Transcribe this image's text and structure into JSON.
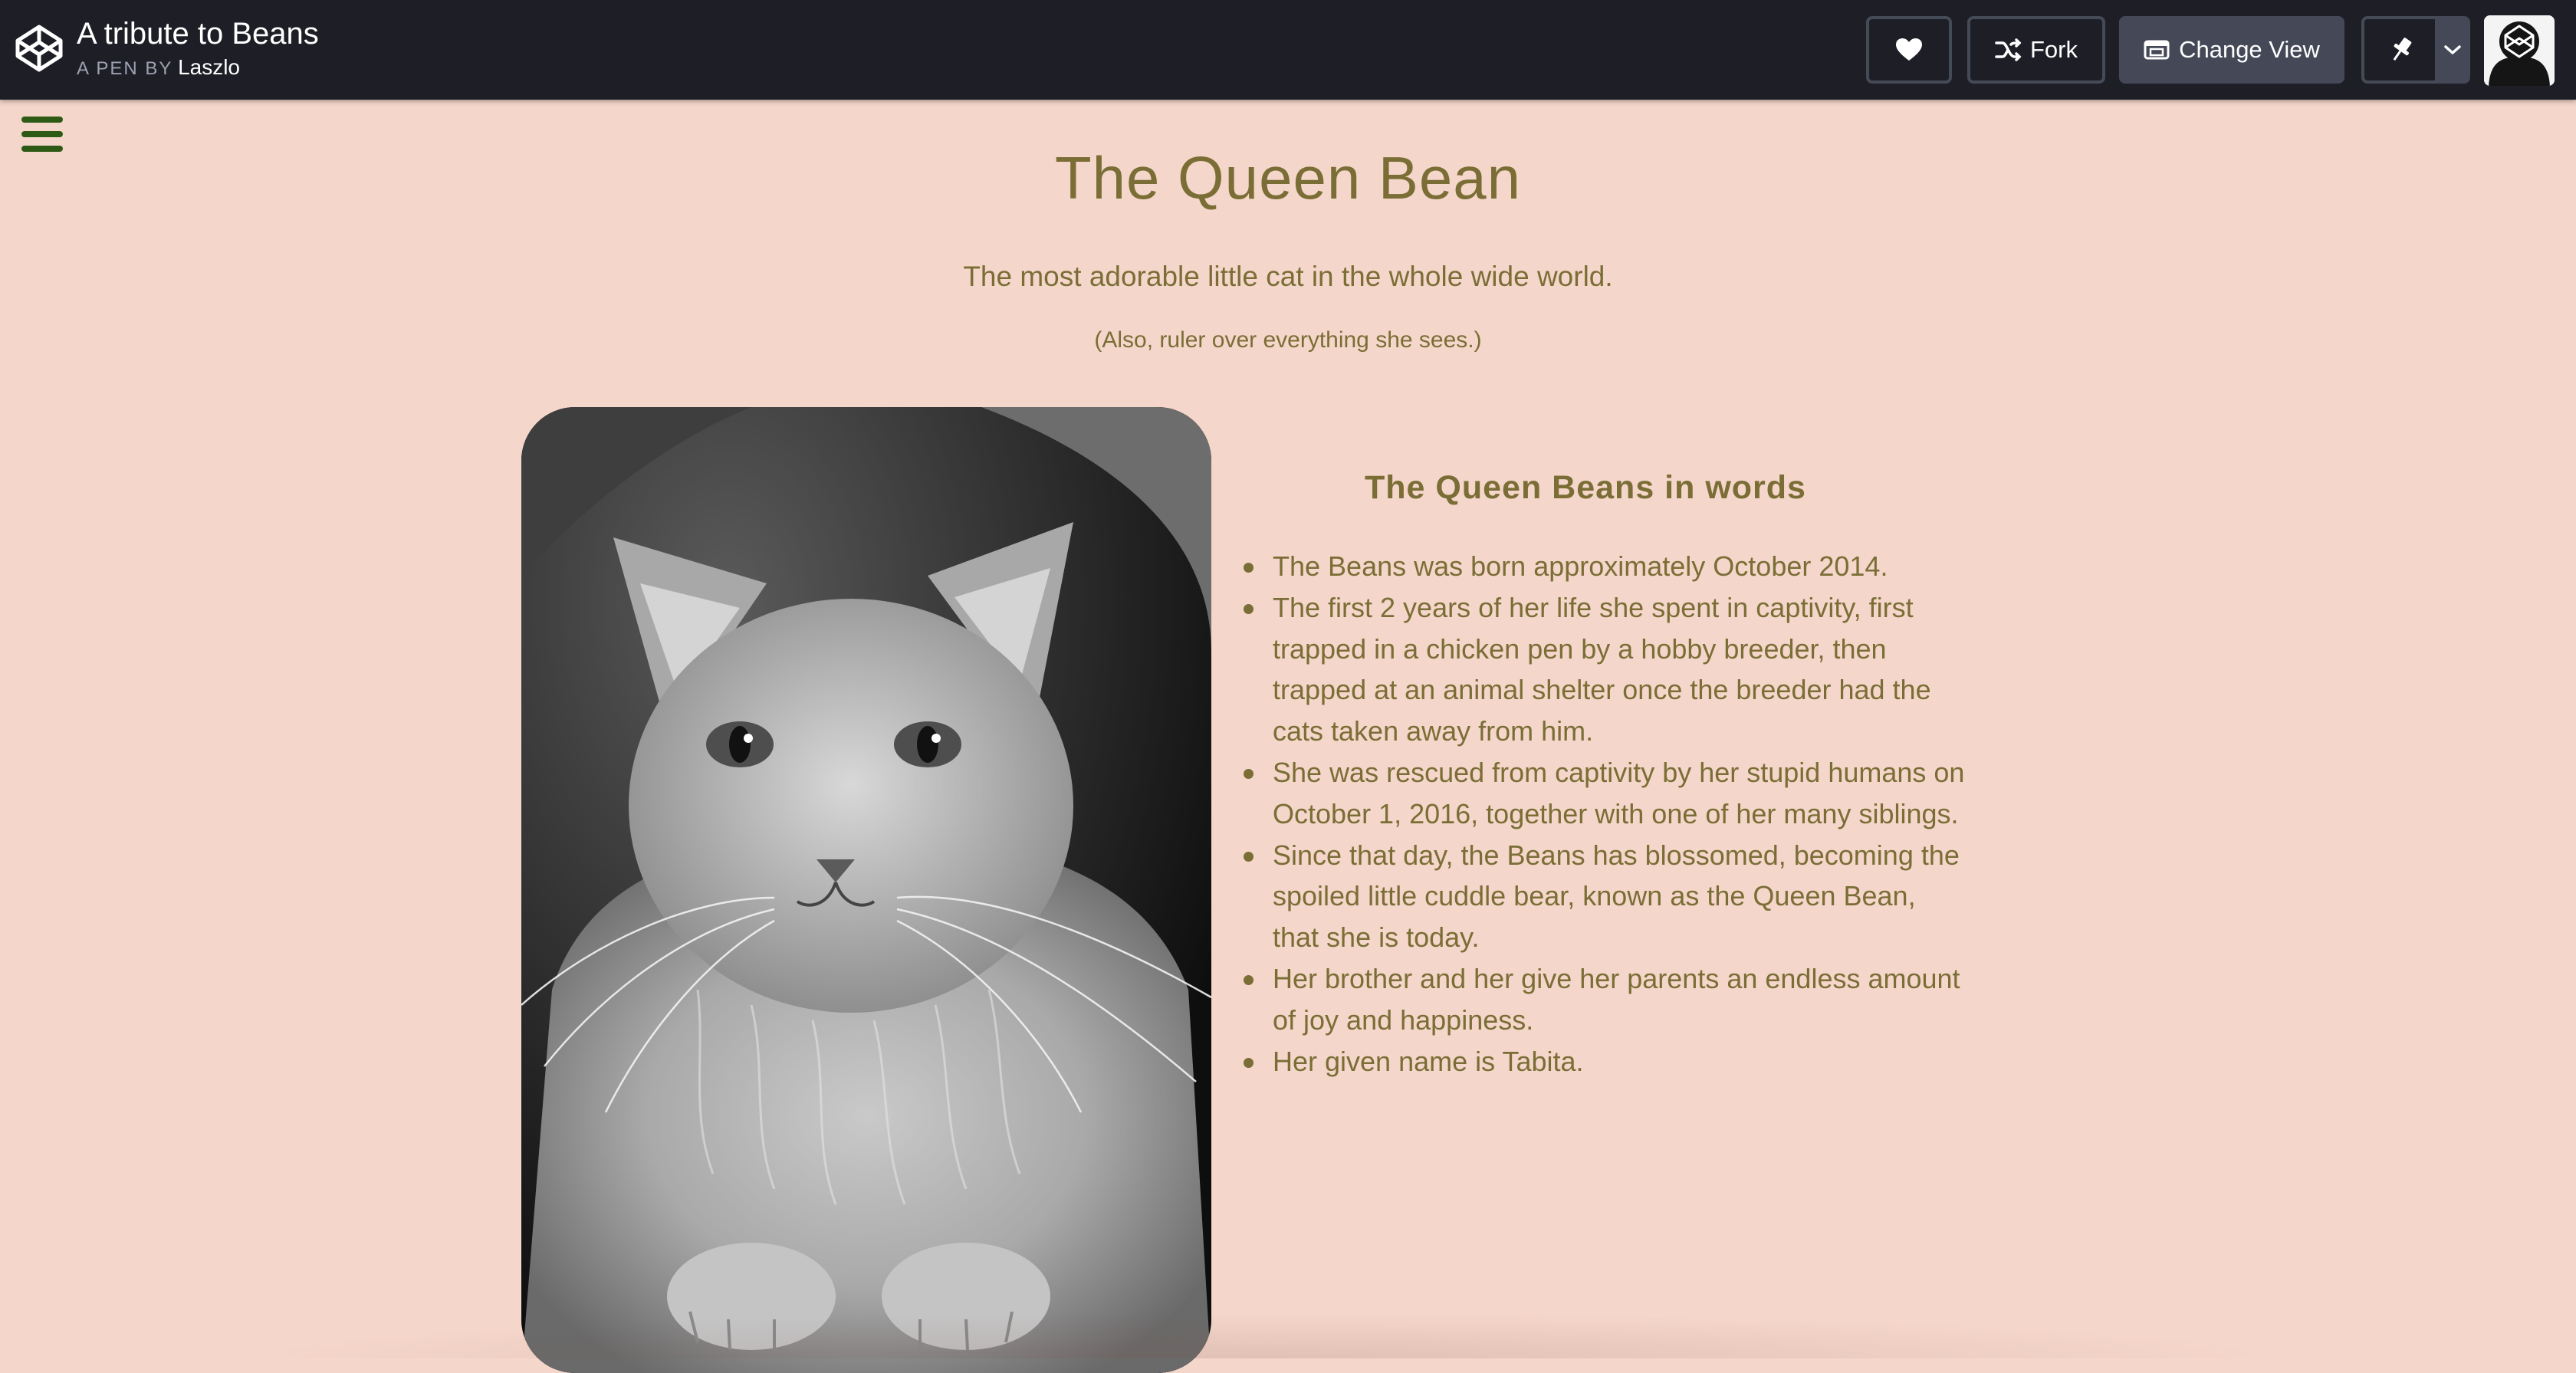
{
  "topbar": {
    "pen_title": "A tribute to Beans",
    "pen_by_label": "A PEN BY",
    "author": "Laszlo",
    "buttons": {
      "heart_icon": "heart-icon",
      "fork_label": "Fork",
      "change_view_label": "Change View",
      "pin_icon": "pin-icon",
      "dropdown_icon": "chevron-down-icon"
    }
  },
  "page": {
    "title": "The Queen Bean",
    "subtitle": "The most adorable little cat in the whole wide world.",
    "aside": "(Also, ruler over everything she sees.)",
    "words_title": "The Queen Beans in words",
    "facts": [
      "The Beans was born approximately October 2014.",
      "The first 2 years of her life she spent in captivity, first trapped in a chicken pen by a hobby breeder, then trapped at an animal shelter once the breeder had the cats taken away from him.",
      "She was rescued from captivity by her stupid humans on October 1, 2016, together with one of her many siblings.",
      "Since that day, the Beans has blossomed, becoming the spoiled little cuddle bear, known as the Queen Bean, that she is today.",
      "Her brother and her give her parents an endless amount of joy and happiness.",
      "Her given name is Tabita."
    ]
  },
  "colors": {
    "background": "#f5d6ca",
    "text": "#7a6e36",
    "topbar": "#1e1f26",
    "hamburger": "#2d5a15"
  }
}
